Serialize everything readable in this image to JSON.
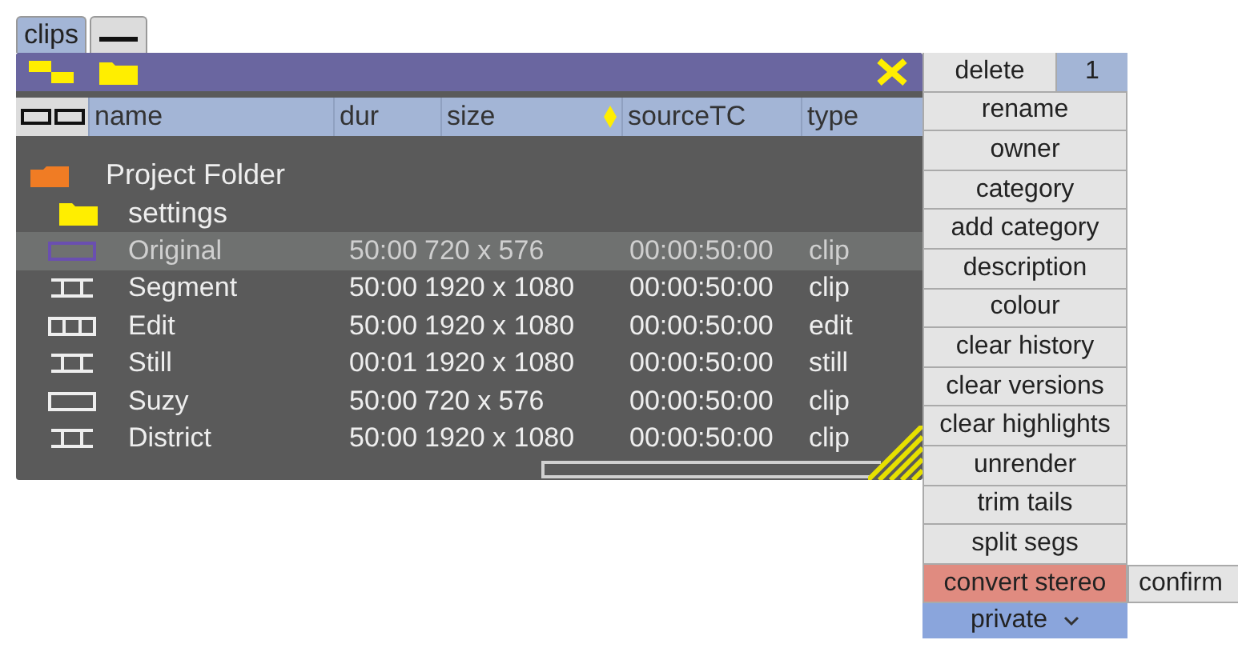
{
  "tabs": [
    {
      "kind": "text",
      "label": "clips",
      "selected": true
    },
    {
      "kind": "minimize",
      "selected": false
    }
  ],
  "table": {
    "columns": [
      {
        "label": "name",
        "sorted": false
      },
      {
        "label": "dur",
        "sorted": false
      },
      {
        "label": "size",
        "sorted": true
      },
      {
        "label": "sourceTC",
        "sorted": false
      },
      {
        "label": "type",
        "sorted": false
      }
    ],
    "folders": [
      {
        "name": "Project Folder",
        "kind": "project"
      },
      {
        "name": "settings",
        "kind": "folder"
      }
    ],
    "rows": [
      {
        "kind": "frame",
        "selected": true,
        "name": "Original",
        "dur": "50:00",
        "size": "720 x 576",
        "sourceTC": "00:00:50:00",
        "type": "clip"
      },
      {
        "kind": "segment",
        "selected": false,
        "name": "Segment",
        "dur": "50:00",
        "size": "1920 x 1080",
        "sourceTC": "00:00:50:00",
        "type": "clip"
      },
      {
        "kind": "edit",
        "selected": false,
        "name": "Edit",
        "dur": "50:00",
        "size": "1920 x 1080",
        "sourceTC": "00:00:50:00",
        "type": "edit"
      },
      {
        "kind": "segment",
        "selected": false,
        "name": "Still",
        "dur": "00:01",
        "size": "1920 x 1080",
        "sourceTC": "00:00:50:00",
        "type": "still"
      },
      {
        "kind": "frame",
        "selected": false,
        "name": "Suzy",
        "dur": "50:00",
        "size": "720 x 576",
        "sourceTC": "00:00:50:00",
        "type": "clip"
      },
      {
        "kind": "segment",
        "selected": false,
        "name": "District",
        "dur": "50:00",
        "size": "1920 x 1080",
        "sourceTC": "00:00:50:00",
        "type": "clip"
      }
    ]
  },
  "menu": {
    "items": [
      {
        "label": "delete",
        "count": "1",
        "armed": false
      },
      {
        "label": "rename",
        "armed": false
      },
      {
        "label": "owner",
        "armed": false
      },
      {
        "label": "category",
        "armed": false
      },
      {
        "label": "add category",
        "armed": false
      },
      {
        "label": "description",
        "armed": false
      },
      {
        "label": "colour",
        "armed": false
      },
      {
        "label": "clear history",
        "armed": false
      },
      {
        "label": "clear versions",
        "armed": false
      },
      {
        "label": "clear highlights",
        "armed": false
      },
      {
        "label": "unrender",
        "armed": false
      },
      {
        "label": "trim tails",
        "armed": false
      },
      {
        "label": "split segs",
        "armed": false
      },
      {
        "label": "convert stereo",
        "armed": true,
        "confirm": "confirm"
      }
    ],
    "privacy": {
      "value": "private"
    }
  }
}
